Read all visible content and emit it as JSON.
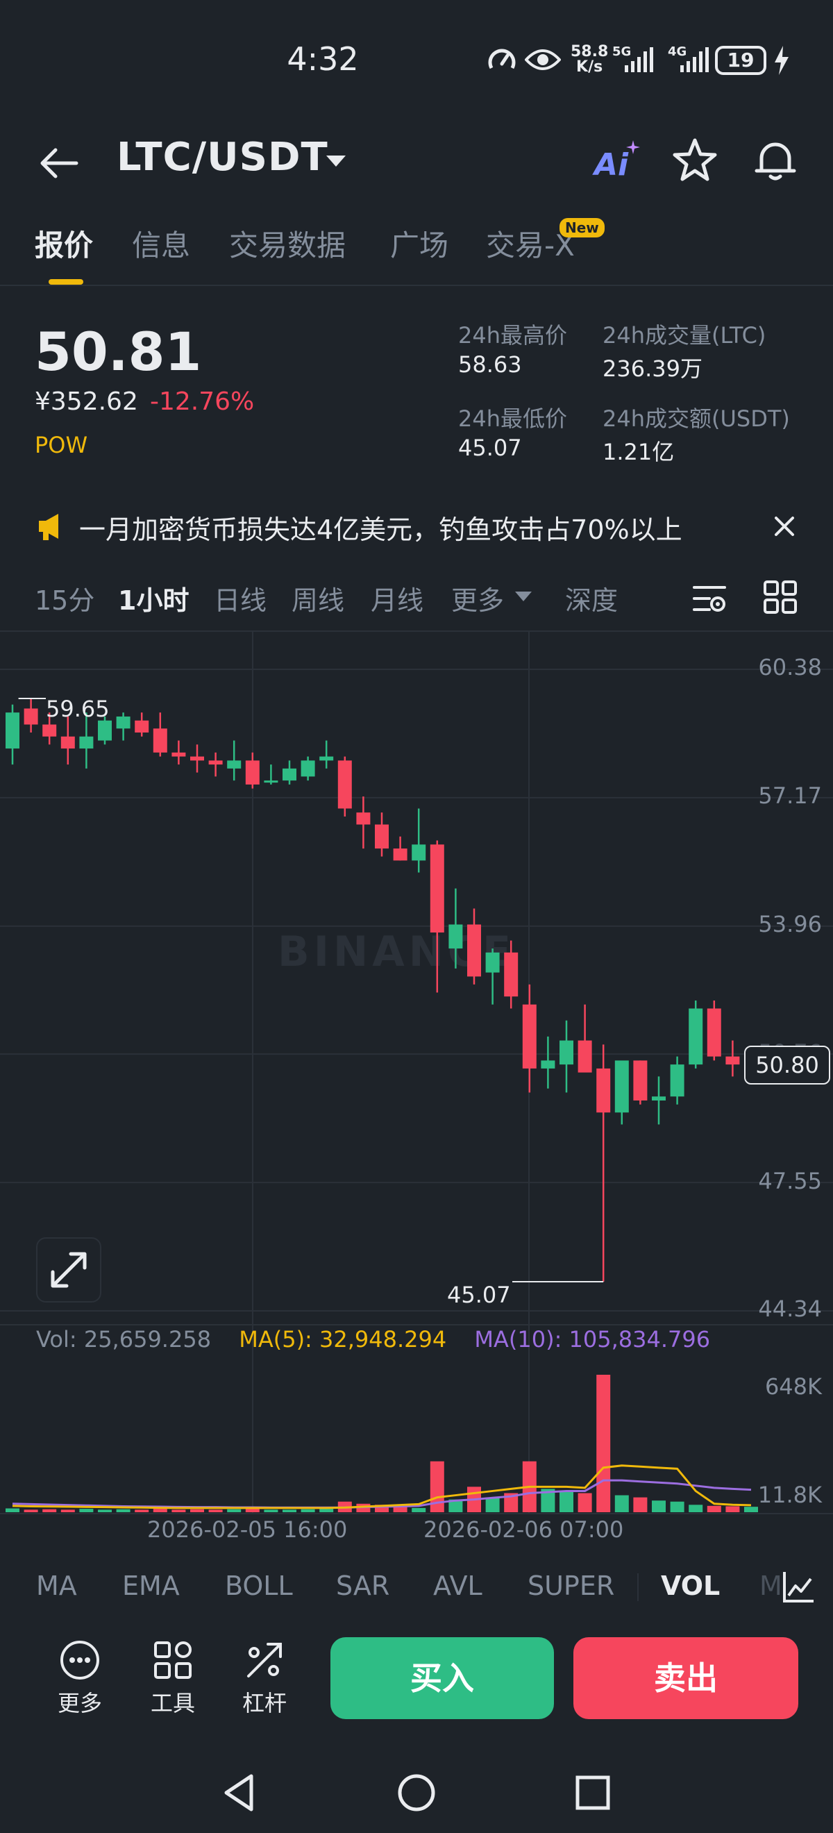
{
  "status_bar": {
    "time": "4:32",
    "net_speed_value": "58.8",
    "net_speed_unit": "K/s",
    "signal_1": "5G",
    "signal_2": "4G",
    "battery": "19"
  },
  "header": {
    "pair": "LTC/USDT",
    "ai_label": "Ai"
  },
  "tabs": [
    {
      "label": "报价",
      "active": true
    },
    {
      "label": "信息",
      "active": false
    },
    {
      "label": "交易数据",
      "active": false
    },
    {
      "label": "广场",
      "active": false
    },
    {
      "label": "交易-X",
      "active": false,
      "badge": "New"
    }
  ],
  "price": {
    "last": "50.81",
    "cny": "¥352.62",
    "change": "-12.76%",
    "tag": "POW",
    "high_label": "24h最高价",
    "high_value": "58.63",
    "low_label": "24h最低价",
    "low_value": "45.07",
    "vol_base_label": "24h成交量(LTC)",
    "vol_base_value": "236.39万",
    "vol_quote_label": "24h成交额(USDT)",
    "vol_quote_value": "1.21亿"
  },
  "announcement": {
    "text": "一月加密货币损失达4亿美元，钓鱼攻击占70%以上"
  },
  "intervals": [
    {
      "label": "15分",
      "active": false
    },
    {
      "label": "1小时",
      "active": true
    },
    {
      "label": "日线",
      "active": false
    },
    {
      "label": "周线",
      "active": false
    },
    {
      "label": "月线",
      "active": false
    },
    {
      "label": "更多",
      "active": false
    },
    {
      "label": "深度",
      "active": false
    }
  ],
  "chart": {
    "watermark": "BINANCE",
    "current_price_tag": "50.80",
    "high_marker": "59.65",
    "low_marker": "45.07",
    "vol_text": "Vol: 25,659.258",
    "ma5_text": "MA(5): 32,948.294",
    "ma10_text": "MA(10): 105,834.796",
    "vol_axis": [
      "648K",
      "11.8K"
    ],
    "dates": [
      "2026-02-05 16:00",
      "2026-02-06 07:00"
    ],
    "colors": {
      "up": "#2ebd85",
      "down": "#f6465d",
      "ma5": "#f0b90b",
      "ma10": "#9c6ee0"
    }
  },
  "chart_data": {
    "type": "candlestick",
    "interval": "1小时",
    "y_ticks": [
      60.38,
      57.17,
      53.96,
      50.76,
      47.55,
      44.34
    ],
    "ylim": [
      44.34,
      60.38
    ],
    "candles": [
      [
        58.4,
        59.5,
        58.0,
        59.3
      ],
      [
        59.4,
        59.65,
        58.8,
        59.0
      ],
      [
        59.0,
        59.3,
        58.5,
        58.7
      ],
      [
        58.7,
        59.2,
        58.0,
        58.4
      ],
      [
        58.4,
        59.3,
        57.9,
        58.7
      ],
      [
        58.6,
        59.2,
        58.5,
        59.1
      ],
      [
        58.9,
        59.3,
        58.6,
        59.2
      ],
      [
        59.1,
        59.3,
        58.7,
        58.8
      ],
      [
        58.9,
        59.3,
        58.2,
        58.3
      ],
      [
        58.3,
        58.6,
        58.0,
        58.2
      ],
      [
        58.2,
        58.5,
        57.8,
        58.1
      ],
      [
        58.1,
        58.3,
        57.7,
        58.0
      ],
      [
        57.9,
        58.6,
        57.6,
        58.1
      ],
      [
        58.1,
        58.3,
        57.4,
        57.5
      ],
      [
        57.6,
        58.0,
        57.5,
        57.6
      ],
      [
        57.6,
        58.1,
        57.5,
        57.9
      ],
      [
        57.7,
        58.2,
        57.6,
        58.1
      ],
      [
        58.1,
        58.6,
        57.9,
        58.2
      ],
      [
        58.1,
        58.2,
        56.7,
        56.9
      ],
      [
        56.8,
        57.2,
        55.9,
        56.5
      ],
      [
        56.5,
        56.8,
        55.7,
        55.9
      ],
      [
        55.9,
        56.2,
        55.6,
        55.6
      ],
      [
        55.6,
        56.9,
        55.3,
        56.0
      ],
      [
        56.0,
        56.1,
        52.3,
        53.8
      ],
      [
        53.4,
        54.9,
        52.9,
        54.0
      ],
      [
        54.0,
        54.4,
        52.5,
        52.7
      ],
      [
        52.8,
        53.4,
        52.0,
        53.3
      ],
      [
        53.3,
        53.6,
        51.9,
        52.2
      ],
      [
        52.0,
        52.5,
        49.8,
        50.4
      ],
      [
        50.4,
        51.2,
        49.9,
        50.6
      ],
      [
        50.5,
        51.6,
        49.8,
        51.1
      ],
      [
        51.1,
        52.0,
        50.5,
        50.3
      ],
      [
        50.4,
        51.0,
        45.07,
        49.3
      ],
      [
        49.3,
        50.5,
        49.0,
        50.6
      ],
      [
        50.6,
        50.6,
        49.5,
        49.6
      ],
      [
        49.6,
        50.2,
        49.0,
        49.7
      ],
      [
        49.7,
        50.7,
        49.5,
        50.5
      ],
      [
        50.5,
        52.1,
        50.4,
        51.9
      ],
      [
        51.9,
        52.1,
        50.6,
        50.7
      ],
      [
        50.7,
        51.1,
        50.2,
        50.5
      ],
      [
        50.5,
        50.9,
        50.3,
        50.8
      ]
    ],
    "volume": {
      "ylim": [
        11800,
        648000
      ],
      "values": [
        18000,
        12000,
        14000,
        12000,
        16000,
        12000,
        14000,
        12000,
        16000,
        12000,
        14000,
        12000,
        14000,
        16000,
        12000,
        12000,
        14000,
        16000,
        50000,
        40000,
        35000,
        30000,
        20000,
        240000,
        60000,
        120000,
        70000,
        90000,
        240000,
        110000,
        100000,
        90000,
        648000,
        80000,
        70000,
        55000,
        50000,
        35000,
        30000,
        28000,
        25659
      ],
      "ma5": [
        30000,
        28000,
        27000,
        26000,
        25000,
        24000,
        23000,
        22000,
        21000,
        20000,
        20000,
        20000,
        20000,
        20000,
        20000,
        20000,
        20000,
        20000,
        22000,
        26000,
        30000,
        34000,
        38000,
        70000,
        80000,
        90000,
        100000,
        110000,
        120000,
        120000,
        120000,
        115000,
        210000,
        220000,
        215000,
        210000,
        205000,
        100000,
        40000,
        35000,
        32948
      ],
      "ma10": [
        40000,
        38000,
        36000,
        34000,
        32000,
        30000,
        28000,
        27000,
        26000,
        25000,
        24000,
        24000,
        23000,
        23000,
        22000,
        22000,
        22000,
        22000,
        22000,
        24000,
        26000,
        28000,
        30000,
        45000,
        55000,
        60000,
        68000,
        75000,
        90000,
        95000,
        100000,
        100000,
        150000,
        150000,
        145000,
        140000,
        135000,
        125000,
        115000,
        110000,
        105834
      ]
    }
  },
  "indicators": [
    {
      "label": "MA",
      "active": false
    },
    {
      "label": "EMA",
      "active": false
    },
    {
      "label": "BOLL",
      "active": false
    },
    {
      "label": "SAR",
      "active": false
    },
    {
      "label": "AVL",
      "active": false
    },
    {
      "label": "SUPER",
      "active": false
    },
    {
      "label": "VOL",
      "active": true
    },
    {
      "label": "M",
      "active": false
    }
  ],
  "actions": {
    "more": "更多",
    "tools": "工具",
    "leverage": "杠杆",
    "buy": "买入",
    "sell": "卖出"
  }
}
